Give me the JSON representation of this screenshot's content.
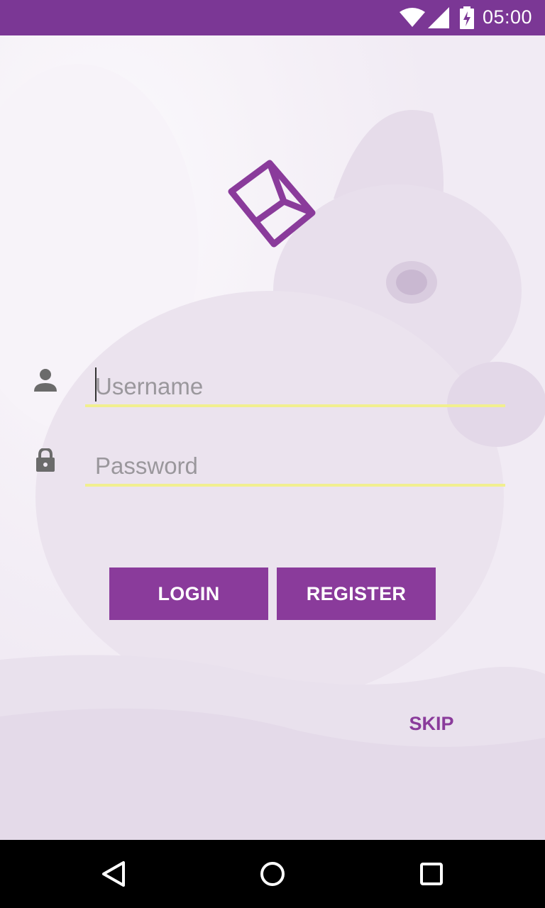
{
  "status_bar": {
    "time": "05:00",
    "icons": [
      "wifi-icon",
      "signal-icon",
      "battery-charging-icon"
    ]
  },
  "login": {
    "username_placeholder": "Username",
    "password_placeholder": "Password",
    "login_label": "LOGIN",
    "register_label": "REGISTER",
    "skip_label": "SKIP"
  },
  "colors": {
    "primary": "#7b3795",
    "button": "#8a3b9b",
    "field_underline": "#f1ef8f",
    "background_tint": "#f1ebf4"
  },
  "nav_bar": {
    "icons": [
      "back-icon",
      "home-icon",
      "recents-icon"
    ]
  }
}
